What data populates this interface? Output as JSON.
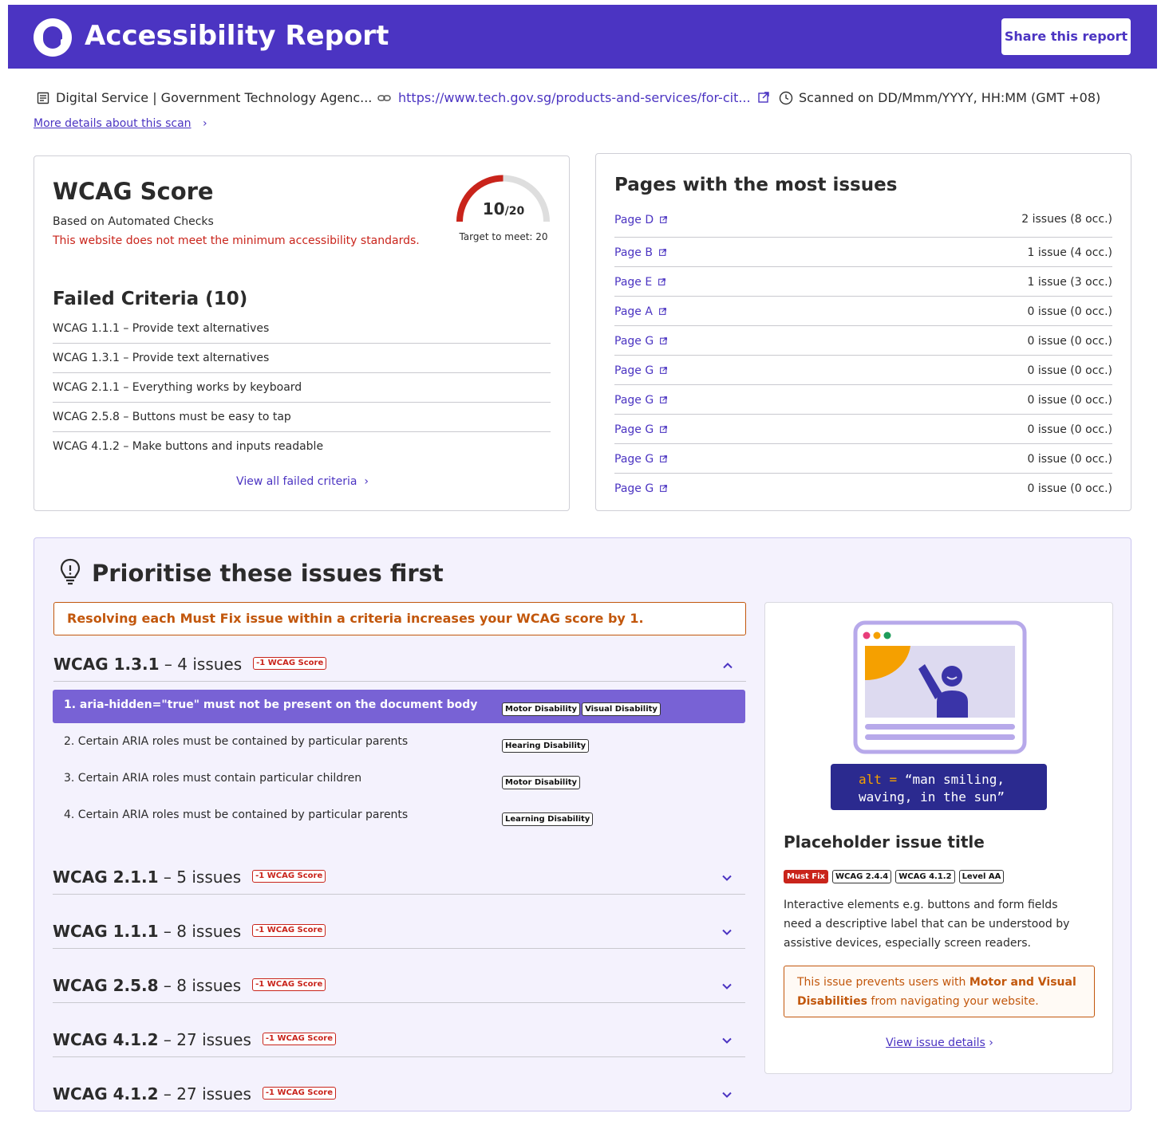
{
  "header": {
    "title": "Accessibility Report",
    "share_label": "Share this report",
    "brand_color": "#4b34c2"
  },
  "meta": {
    "site_name": "Digital Service | Government Technology Agenc...",
    "url": "https://www.tech.gov.sg/products-and-services/for-cit...",
    "scanned": "Scanned on DD/Mmm/YYYY, HH:MM (GMT +08)",
    "more_details": "More details about this scan",
    "icons": [
      "document-icon",
      "link-icon",
      "external-link-icon",
      "clock-icon",
      "chevron-right-icon"
    ]
  },
  "score": {
    "title": "WCAG Score",
    "subtitle": "Based on Automated Checks",
    "warning": "This website does not meet the minimum accessibility standards.",
    "value": "10",
    "max": "/20",
    "target": "Target to meet: 20",
    "gauge_fraction": 0.5,
    "gauge_color": "#c9241b",
    "failed_title": "Failed Criteria (10)",
    "failed": [
      "WCAG 1.1.1 – Provide text alternatives",
      "WCAG 1.3.1 – Provide text alternatives",
      "WCAG 2.1.1 – Everything works by keyboard",
      "WCAG 2.5.8 – Buttons must be easy to tap",
      "WCAG 4.1.2 – Make buttons and inputs readable"
    ],
    "view_all": "View all failed criteria"
  },
  "pages": {
    "title": "Pages with the most issues",
    "items": [
      {
        "name": "Page D",
        "count": "2 issues (8 occ.)"
      },
      {
        "name": "Page B",
        "count": "1 issue (4 occ.)"
      },
      {
        "name": "Page E",
        "count": "1 issue (3 occ.)"
      },
      {
        "name": "Page A",
        "count": "0 issue (0 occ.)"
      },
      {
        "name": "Page G",
        "count": "0 issue (0 occ.)"
      },
      {
        "name": "Page G",
        "count": "0 issue (0 occ.)"
      },
      {
        "name": "Page G",
        "count": "0 issue (0 occ.)"
      },
      {
        "name": "Page G",
        "count": "0 issue (0 occ.)"
      },
      {
        "name": "Page G",
        "count": "0 issue (0 occ.)"
      },
      {
        "name": "Page G",
        "count": "0 issue (0 occ.)"
      }
    ]
  },
  "prioritise": {
    "title": "Prioritise these issues first",
    "notice": "Resolving each Must Fix issue within a criteria increases your WCAG score by 1.",
    "criteria": [
      {
        "code": "WCAG 1.3.1",
        "count": " – 4 issues",
        "badge": "-1 WCAG Score",
        "expanded": true
      },
      {
        "code": "WCAG 2.1.1",
        "count": " – 5 issues",
        "badge": "-1 WCAG Score",
        "expanded": false
      },
      {
        "code": "WCAG 1.1.1",
        "count": " – 8 issues",
        "badge": "-1 WCAG Score",
        "expanded": false
      },
      {
        "code": "WCAG 2.5.8",
        "count": " – 8 issues",
        "badge": "-1 WCAG Score",
        "expanded": false
      },
      {
        "code": "WCAG 4.1.2",
        "count": " – 27 issues",
        "badge": "-1 WCAG Score",
        "expanded": false
      },
      {
        "code": "WCAG 4.1.2",
        "count": " – 27 issues",
        "badge": "-1 WCAG Score",
        "expanded": false
      }
    ],
    "issues": [
      {
        "label": "1. aria-hidden=\"true\" must not be present on the document body",
        "tags": [
          "Motor Disability",
          "Visual Disability"
        ],
        "selected": true
      },
      {
        "label": "2. Certain ARIA roles must be contained by particular parents",
        "tags": [
          "Hearing Disability"
        ],
        "selected": false
      },
      {
        "label": "3. Certain ARIA roles must contain particular children",
        "tags": [
          "Motor Disability"
        ],
        "selected": false
      },
      {
        "label": "4. Certain ARIA roles must be contained by particular parents",
        "tags": [
          "Learning Disability"
        ],
        "selected": false
      }
    ]
  },
  "detail": {
    "code_alt": "alt",
    "code_eq": " = ",
    "code_line1": "“man smiling,",
    "code_line2": "waving, in the sun”",
    "title": "Placeholder issue title",
    "tags": [
      "Must Fix",
      "WCAG 2.4.4",
      "WCAG 4.1.2",
      "Level AA"
    ],
    "description": "Interactive elements e.g. buttons and form fields need a descriptive label that can be understood by assistive devices, especially screen readers.",
    "impact_prefix": "This issue prevents users with ",
    "impact_bold": "Motor and Visual Disabilities",
    "impact_suffix": " from navigating your website.",
    "view_label": "View issue details"
  }
}
